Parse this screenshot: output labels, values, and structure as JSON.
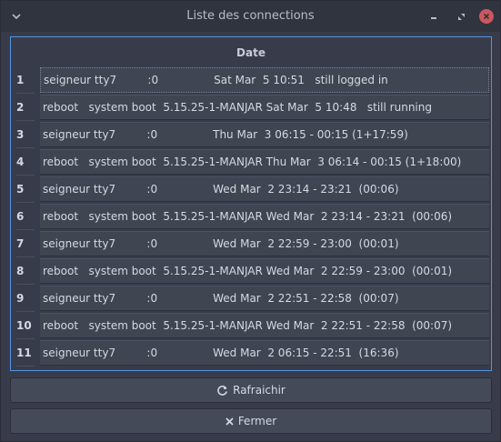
{
  "window": {
    "title": "Liste des connections"
  },
  "table": {
    "header": "Date",
    "rows": [
      {
        "num": "1",
        "text": "seigneur tty7         :0                Sat Mar  5 10:51   still logged in"
      },
      {
        "num": "2",
        "text": "reboot   system boot  5.15.25-1-MANJAR Sat Mar  5 10:48   still running"
      },
      {
        "num": "3",
        "text": "seigneur tty7         :0                Thu Mar  3 06:15 - 00:15 (1+17:59)"
      },
      {
        "num": "4",
        "text": "reboot   system boot  5.15.25-1-MANJAR Thu Mar  3 06:14 - 00:15 (1+18:00)"
      },
      {
        "num": "5",
        "text": "seigneur tty7         :0                Wed Mar  2 23:14 - 23:21  (00:06)"
      },
      {
        "num": "6",
        "text": "reboot   system boot  5.15.25-1-MANJAR Wed Mar  2 23:14 - 23:21  (00:06)"
      },
      {
        "num": "7",
        "text": "seigneur tty7         :0                Wed Mar  2 22:59 - 23:00  (00:01)"
      },
      {
        "num": "8",
        "text": "reboot   system boot  5.15.25-1-MANJAR Wed Mar  2 22:59 - 23:00  (00:01)"
      },
      {
        "num": "9",
        "text": "seigneur tty7         :0                Wed Mar  2 22:51 - 22:58  (00:07)"
      },
      {
        "num": "10",
        "text": "reboot   system boot  5.15.25-1-MANJAR Wed Mar  2 22:51 - 22:58  (00:07)"
      },
      {
        "num": "11",
        "text": "seigneur tty7         :0                Wed Mar  2 06:15 - 22:51  (16:36)"
      }
    ]
  },
  "buttons": {
    "refresh_label": "Rafraichir",
    "close_label": "Fermer"
  },
  "icons": {
    "menu": "chevron-down-icon",
    "minimize": "minimize-icon",
    "maximize": "maximize-icon",
    "close": "close-icon",
    "refresh": "refresh-icon",
    "cancel": "x-icon"
  },
  "colors": {
    "accent": "#5294e2",
    "close": "#cc575d",
    "background": "#383c4a"
  }
}
